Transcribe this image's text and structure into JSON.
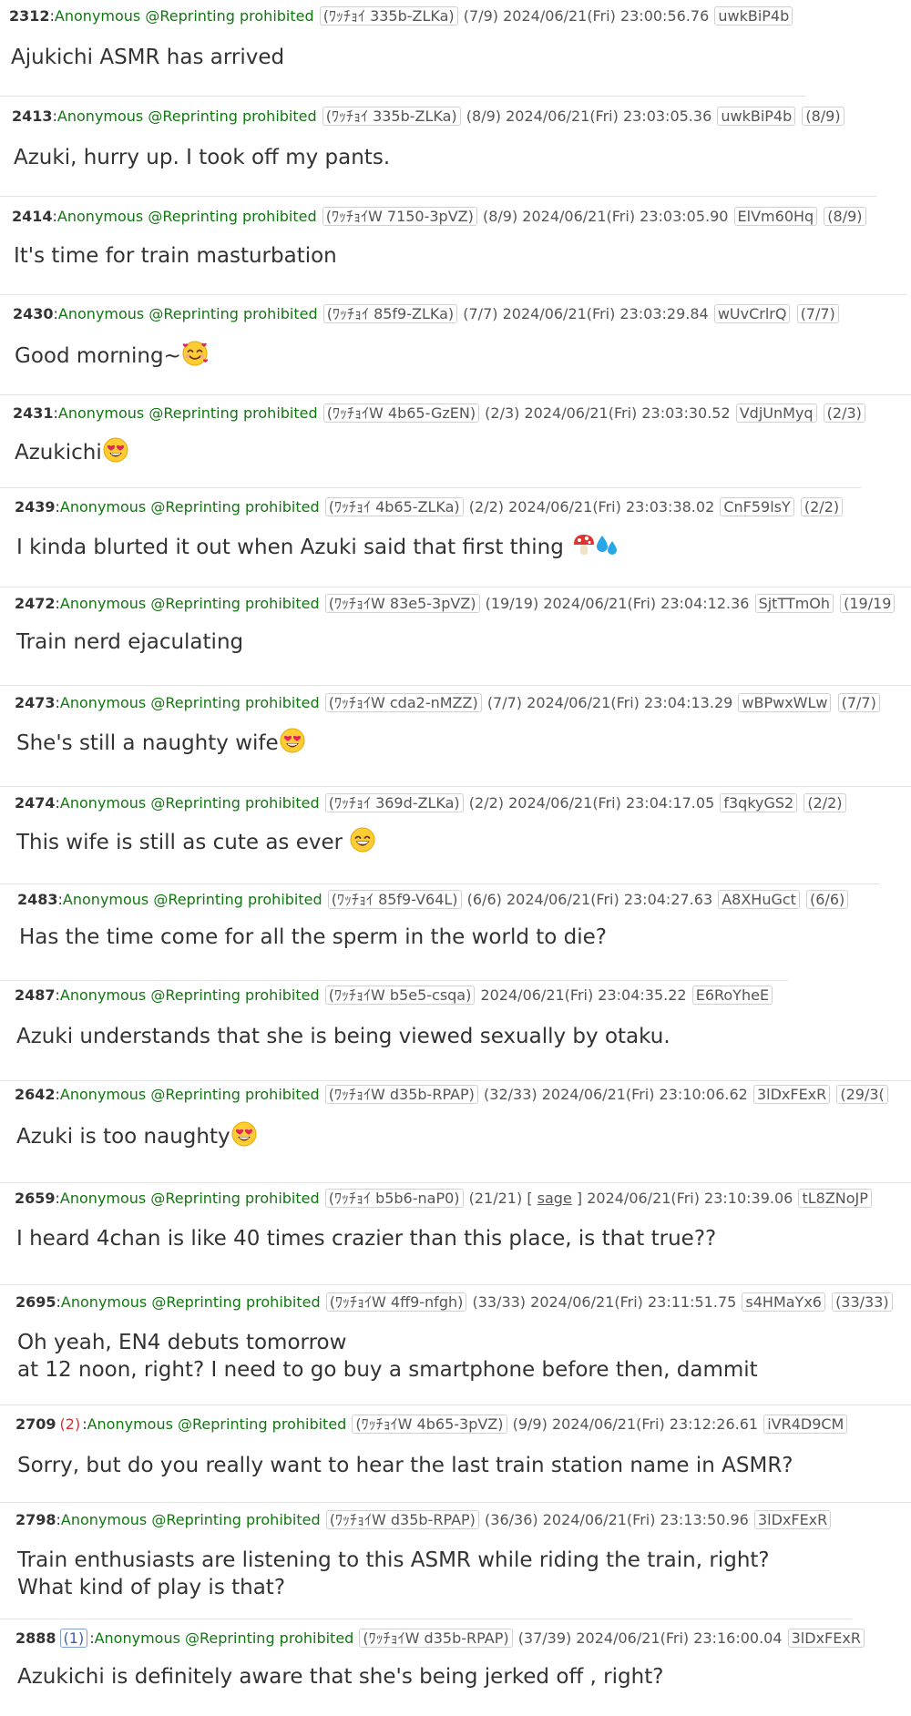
{
  "colors": {
    "name_green": "#117711",
    "reply_red": "#d9302a",
    "text": "#333333",
    "separator": "#e3e3e3"
  },
  "posts": [
    {
      "number": "2312",
      "name": "Anonymous @Reprinting prohibited",
      "tag": "(ﾜｯﾁｮｲ 335b-ZLKa)",
      "post_count": "(7/9)",
      "datetime": "2024/06/21(Fri) 23:00:56.76",
      "id": "uwkBiP4b",
      "lines": [
        "Ajukichi ASMR has arrived"
      ]
    },
    {
      "number": "2413",
      "name": "Anonymous @Reprinting prohibited",
      "tag": "(ﾜｯﾁｮｲ 335b-ZLKa)",
      "post_count": "(8/9)",
      "datetime": "2024/06/21(Fri) 23:03:05.36",
      "id": "uwkBiP4b",
      "id_count": "(8/9)",
      "lines": [
        "Azuki, hurry up. I took off my pants."
      ]
    },
    {
      "number": "2414",
      "name": "Anonymous @Reprinting prohibited",
      "tag": "(ﾜｯﾁｮｲW 7150-3pVZ)",
      "post_count": "(8/9)",
      "datetime": "2024/06/21(Fri) 23:03:05.90",
      "id": "ElVm60Hq",
      "id_count": "(8/9)",
      "lines": [
        "It's time for train masturbation"
      ]
    },
    {
      "number": "2430",
      "name": "Anonymous @Reprinting prohibited",
      "tag": "(ﾜｯﾁｮｲ 85f9-ZLKa)",
      "post_count": "(7/7)",
      "datetime": "2024/06/21(Fri) 23:03:29.84",
      "id": "wUvCrlrQ",
      "id_count": "(7/7)",
      "lines": [
        "Good morning~"
      ],
      "emoji": "smiling-face-with-hearts-emoji"
    },
    {
      "number": "2431",
      "name": "Anonymous @Reprinting prohibited",
      "tag": "(ﾜｯﾁｮｲW 4b65-GzEN)",
      "post_count": "(2/3)",
      "datetime": "2024/06/21(Fri) 23:03:30.52",
      "id": "VdjUnMyq",
      "id_count": "(2/3)",
      "lines": [
        "Azukichi"
      ],
      "emoji": "heart-eyes-emoji"
    },
    {
      "number": "2439",
      "name": "Anonymous @Reprinting prohibited",
      "tag": "(ﾜｯﾁｮｲ 4b65-ZLKa)",
      "post_count": "(2/2)",
      "datetime": "2024/06/21(Fri) 23:03:38.02",
      "id": "CnF59lsY",
      "id_count": "(2/2)",
      "lines": [
        "I kinda blurted it out when Azuki said that first thing "
      ],
      "emoji": "mushroom-and-droplets-emoji"
    },
    {
      "number": "2472",
      "name": "Anonymous @Reprinting prohibited",
      "tag": "(ﾜｯﾁｮｲW 83e5-3pVZ)",
      "post_count": "(19/19)",
      "datetime": "2024/06/21(Fri) 23:04:12.36",
      "id": "SjtTTmOh",
      "id_count": "(19/19",
      "lines": [
        "Train nerd ejaculating"
      ]
    },
    {
      "number": "2473",
      "name": "Anonymous @Reprinting prohibited",
      "tag": "(ﾜｯﾁｮｲW cda2-nMZZ)",
      "post_count": "(7/7)",
      "datetime": "2024/06/21(Fri) 23:04:13.29",
      "id": "wBPwxWLw",
      "id_count": "(7/7)",
      "lines": [
        "She's still a naughty wife"
      ],
      "emoji": "heart-eyes-emoji"
    },
    {
      "number": "2474",
      "name": "Anonymous @Reprinting prohibited",
      "tag": "(ﾜｯﾁｮｲ 369d-ZLKa)",
      "post_count": "(2/2)",
      "datetime": "2024/06/21(Fri) 23:04:17.05",
      "id": "f3qkyGS2",
      "id_count": "(2/2)",
      "lines": [
        "This wife is still as cute as ever "
      ],
      "emoji": "grinning-face-emoji"
    },
    {
      "number": "2483",
      "name": "Anonymous @Reprinting prohibited",
      "tag": "(ﾜｯﾁｮｲ 85f9-V64L)",
      "post_count": "(6/6)",
      "datetime": "2024/06/21(Fri) 23:04:27.63",
      "id": "A8XHuGct",
      "id_count": "(6/6)",
      "lines": [
        "Has the time come for all the sperm in the world to die?"
      ]
    },
    {
      "number": "2487",
      "name": "Anonymous @Reprinting prohibited",
      "tag": "(ﾜｯﾁｮｲW b5e5-csqa)",
      "datetime": "2024/06/21(Fri) 23:04:35.22",
      "id": "E6RoYheE",
      "lines": [
        "Azuki understands that she is being viewed sexually by otaku."
      ]
    },
    {
      "number": "2642",
      "name": "Anonymous @Reprinting prohibited",
      "tag": "(ﾜｯﾁｮｲW d35b-RPAP)",
      "post_count": "(32/33)",
      "datetime": "2024/06/21(Fri) 23:10:06.62",
      "id": "3lDxFExR",
      "id_count": "(29/3(",
      "lines": [
        "Azuki is too naughty"
      ],
      "emoji": "heart-eyes-emoji"
    },
    {
      "number": "2659",
      "name": "Anonymous @Reprinting prohibited",
      "tag": "(ﾜｯﾁｮｲ b5b6-naP0)",
      "post_count": "(21/21)",
      "sage": "sage",
      "datetime": "2024/06/21(Fri) 23:10:39.06",
      "id": "tL8ZNoJP",
      "lines": [
        "I heard 4chan is like 40 times crazier than this place, is that true??"
      ]
    },
    {
      "number": "2695",
      "name": "Anonymous @Reprinting prohibited",
      "tag": "(ﾜｯﾁｮｲW 4ff9-nfgh)",
      "post_count": "(33/33)",
      "datetime": "2024/06/21(Fri) 23:11:51.75",
      "id": "s4HMaYx6",
      "id_count": "(33/33)",
      "lines": [
        "Oh yeah, EN4 debuts tomorrow",
        "at 12 noon, right? I need to go buy a smartphone before then, dammit"
      ]
    },
    {
      "number": "2709",
      "reply_count": "(2)",
      "name": "Anonymous @Reprinting prohibited",
      "tag": "(ﾜｯﾁｮｲW 4b65-3pVZ)",
      "post_count": "(9/9)",
      "datetime": "2024/06/21(Fri) 23:12:26.61",
      "id": "iVR4D9CM",
      "lines": [
        "Sorry, but do you really want to hear the last train station name in ASMR?"
      ]
    },
    {
      "number": "2798",
      "name": "Anonymous @Reprinting prohibited",
      "tag": "(ﾜｯﾁｮｲW d35b-RPAP)",
      "post_count": "(36/36)",
      "datetime": "2024/06/21(Fri) 23:13:50.96",
      "id": "3lDxFExR",
      "lines": [
        "Train enthusiasts are listening to this ASMR while riding the train, right?",
        "What kind of play is that?"
      ]
    },
    {
      "number": "2888",
      "reply_count": "(1)",
      "name": "Anonymous @Reprinting prohibited",
      "tag": "(ﾜｯﾁｮｲW d35b-RPAP)",
      "post_count": "(37/39)",
      "datetime": "2024/06/21(Fri) 23:16:00.04",
      "id": "3lDxFExR",
      "lines": [
        "Azukichi is definitely aware that she's being jerked off , right?"
      ]
    }
  ]
}
